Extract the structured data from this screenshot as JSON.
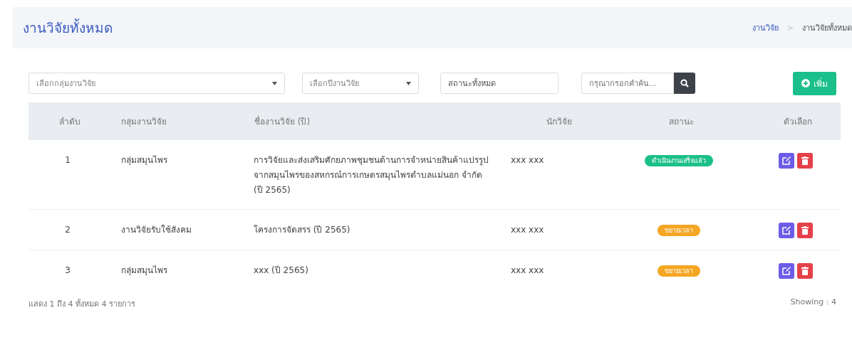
{
  "page_title": "งานวิจัยทั้งหมด",
  "breadcrumb": [
    {
      "label": "งานวิจัย",
      "link": true
    },
    {
      "label": "งานวิจัยทั้งหมด",
      "link": false
    }
  ],
  "breadcrumb_separator": ">",
  "filters": {
    "group_select": {
      "placeholder": "เลือกกลุ่มงานวิจัย"
    },
    "year_select": {
      "placeholder": "เลือกปีงานวิจัย"
    },
    "status_field": {
      "value": "สถานะทั้งหมด"
    },
    "search": {
      "placeholder": "กรุณากรอกคำค้น..."
    }
  },
  "add_button": "เพิ่ม",
  "table": {
    "columns": [
      "ลำดับ",
      "กลุ่มงานวิจัย",
      "ชื่องานวิจัย (ปี)",
      "นักวิจัย",
      "สถานะ",
      "ตัวเลือก"
    ],
    "rows": [
      {
        "no": "1",
        "group": "กลุ่มสมุนไพร",
        "title": "การวิจัยและส่งเสริมศักยภาพชุมชนด้านการจำหน่ายสินค้าแปรรูปจากสมุนไพรของสหกรณ์การเกษตรสมุนไพรตำบลแม่นอก จำกัด (ปี 2565)",
        "researcher": "xxx xxx",
        "status": {
          "label": "ดำเนินงานเสร็จแล้ว",
          "color": "#1bbf8a"
        }
      },
      {
        "no": "2",
        "group": "งานวิจัยรับใช้สังคม",
        "title": "โครงการจัดสรร (ปี 2565)",
        "researcher": "xxx xxx",
        "status": {
          "label": "ขยายเวลา",
          "color": "#f5a623"
        }
      },
      {
        "no": "3",
        "group": "กลุ่มสมุนไพร",
        "title": "xxx (ปี 2565)",
        "researcher": "xxx xxx",
        "status": {
          "label": "ขยายเวลา",
          "color": "#f5a623"
        }
      }
    ]
  },
  "footer": {
    "summary": "แสดง 1 ถึง 4 ทั้งหมด 4 รายการ",
    "showing": "Showing : 4"
  }
}
